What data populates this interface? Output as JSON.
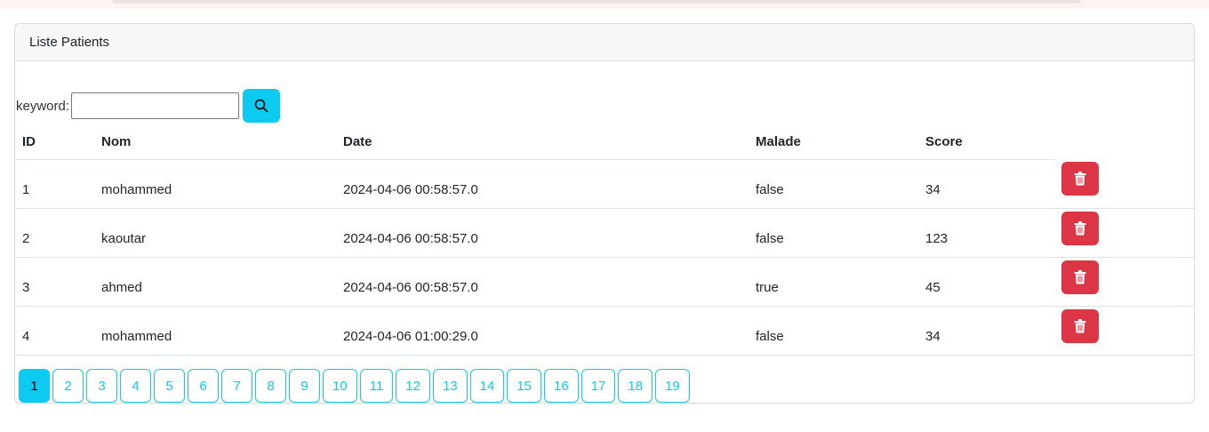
{
  "card": {
    "title": "Liste Patients"
  },
  "search": {
    "label": "keyword:",
    "value": "",
    "placeholder": "",
    "icon": "search-icon"
  },
  "table": {
    "headers": [
      "ID",
      "Nom",
      "Date",
      "Malade",
      "Score"
    ],
    "rows": [
      [
        "1",
        "mohammed",
        "2024-04-06 00:58:57.0",
        "false",
        "34"
      ],
      [
        "2",
        "kaoutar",
        "2024-04-06 00:58:57.0",
        "false",
        "123"
      ],
      [
        "3",
        "ahmed",
        "2024-04-06 00:58:57.0",
        "true",
        "45"
      ],
      [
        "4",
        "mohammed",
        "2024-04-06 01:00:29.0",
        "false",
        "34"
      ]
    ],
    "row_action_icon": "trash-icon"
  },
  "pagination": {
    "pages": [
      "1",
      "2",
      "3",
      "4",
      "5",
      "6",
      "7",
      "8",
      "9",
      "10",
      "11",
      "12",
      "13",
      "14",
      "15",
      "16",
      "17",
      "18",
      "19"
    ],
    "current": "1"
  },
  "colors": {
    "info": "#0dcaf0",
    "danger": "#dc3545",
    "border": "#dee2e6"
  }
}
